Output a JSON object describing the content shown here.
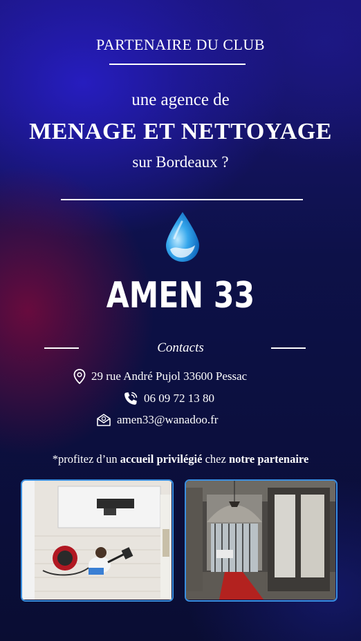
{
  "header": {
    "kicker": "PARTENAIRE DU CLUB",
    "lead": "une agence de",
    "headline": "MENAGE ET NETTOYAGE",
    "sub": "sur Bordeaux ?"
  },
  "brand": {
    "name": "AMEN 33",
    "logo_icon": "water-drop-icon"
  },
  "contacts": {
    "label": "Contacts",
    "address": "29 rue André Pujol 33600 Pessac",
    "address_icon": "location-pin-icon",
    "phone": "06 09 72 13 80",
    "phone_icon": "phone-icon",
    "email": "amen33@wanadoo.fr",
    "email_icon": "envelope-icon"
  },
  "note": {
    "prefix": "*profitez d’un ",
    "bold1": "accueil privilégié",
    "middle": " chez ",
    "bold2": "notre partenaire"
  },
  "photos": {
    "left_icon": "cleaning-office-photo",
    "right_icon": "building-entrance-photo"
  },
  "colors": {
    "background": "#0b0f3a",
    "accent": "#3a8fe0",
    "text": "#ffffff"
  }
}
